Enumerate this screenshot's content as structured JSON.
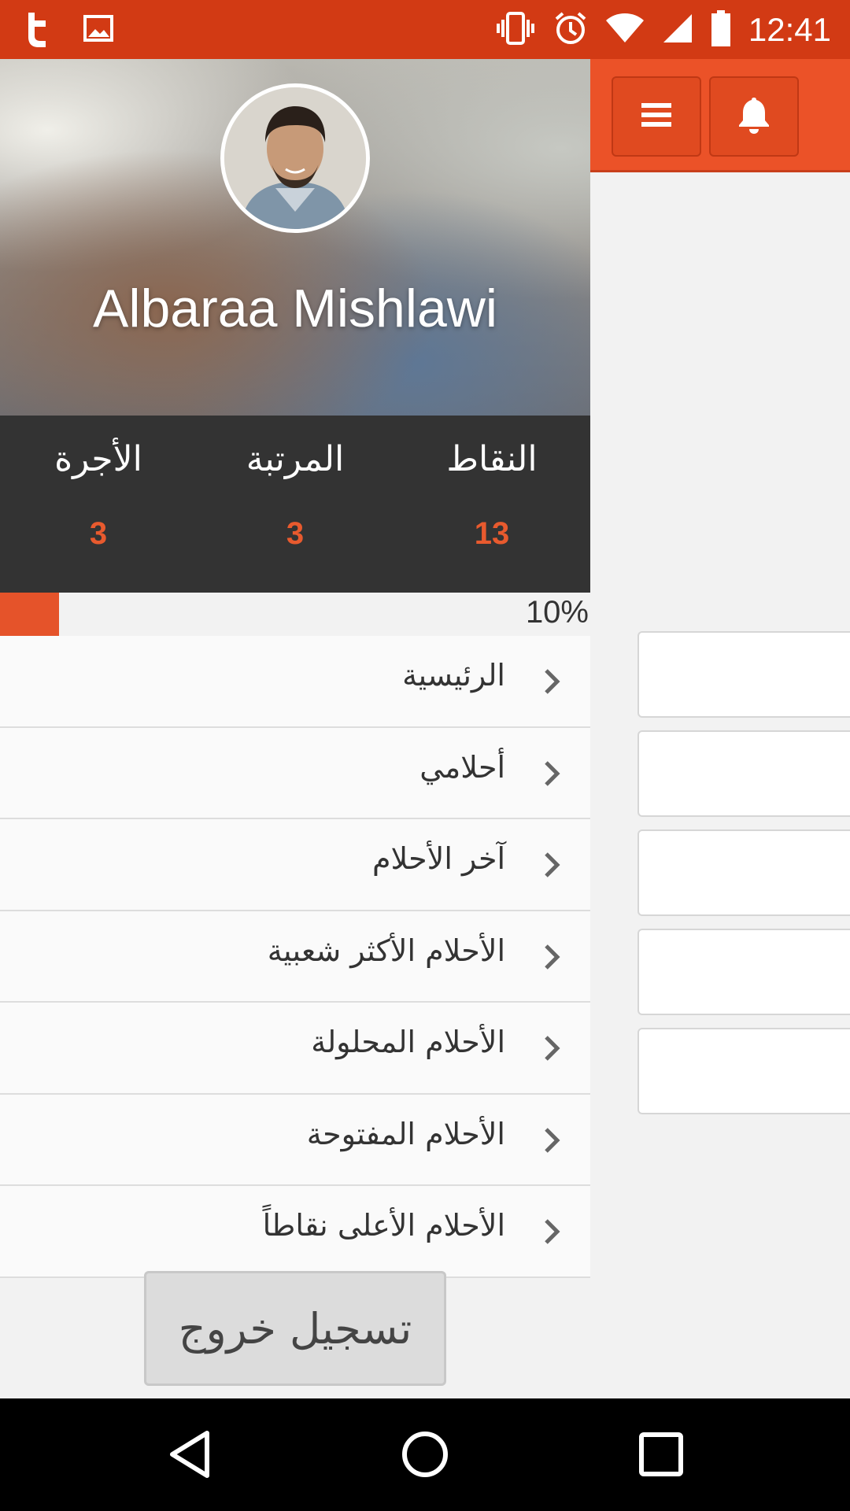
{
  "status_bar": {
    "time": "12:41",
    "icons": [
      "app-t-icon",
      "image-icon",
      "vibrate-icon",
      "alarm-icon",
      "wifi-icon",
      "signal-icon",
      "battery-icon"
    ]
  },
  "profile": {
    "name": "Albaraa Mishlawi"
  },
  "stats": [
    {
      "label": "الأجرة",
      "value": "3"
    },
    {
      "label": "المرتبة",
      "value": "3"
    },
    {
      "label": "النقاط",
      "value": "13"
    }
  ],
  "progress": {
    "text": "10%",
    "fraction": 0.1
  },
  "menu": {
    "items": [
      {
        "label": "الرئيسية"
      },
      {
        "label": "أحلامي"
      },
      {
        "label": "آخر الأحلام"
      },
      {
        "label": "الأحلام الأكثر شعبية"
      },
      {
        "label": "الأحلام المحلولة"
      },
      {
        "label": "الأحلام المفتوحة"
      },
      {
        "label": "الأحلام الأعلى نقاطاً"
      }
    ]
  },
  "logout": {
    "label": "تسجيل خروج"
  },
  "colors": {
    "accent": "#eb5228",
    "status_bar": "#d23a14",
    "stats_bg": "#333333",
    "stat_value": "#e85a2e"
  }
}
